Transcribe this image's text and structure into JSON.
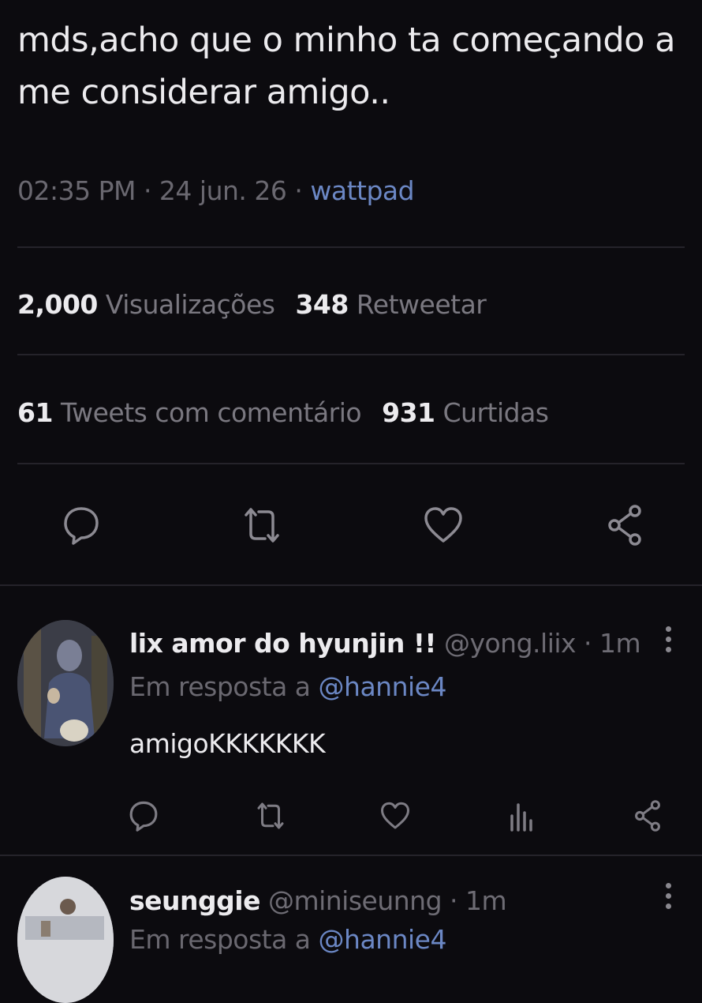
{
  "tweet": {
    "text": "mds,acho que o minho ta começando a me considerar amigo..",
    "time_date": "02:35 PM · 24 jun. 26 · ",
    "source": "wattpad"
  },
  "stats": {
    "views_count": "2,000",
    "views_label": "Visualizações",
    "retweets_count": "348",
    "retweets_label": "Retweetar",
    "quotes_count": "61",
    "quotes_label": "Tweets com comentário",
    "likes_count": "931",
    "likes_label": "Curtidas"
  },
  "actions": {
    "icons": [
      "comment-icon",
      "retweet-icon",
      "heart-icon",
      "share-icon"
    ]
  },
  "replies": [
    {
      "name": "lix amor do hyunjin !!",
      "handle": " @yong.liix · 1m",
      "in_reply_prefix": "Em resposta a ",
      "in_reply_mention": "@hannie4",
      "text": "amigoKKKKKKK"
    },
    {
      "name": "seunggie",
      "handle": " @miniseunng · 1m",
      "in_reply_prefix": "Em resposta a ",
      "in_reply_mention": "@hannie4"
    }
  ],
  "colors": {
    "background": "#0c0b0f",
    "link": "#6b87c4",
    "muted": "#6a6870",
    "text": "#ecebee"
  }
}
